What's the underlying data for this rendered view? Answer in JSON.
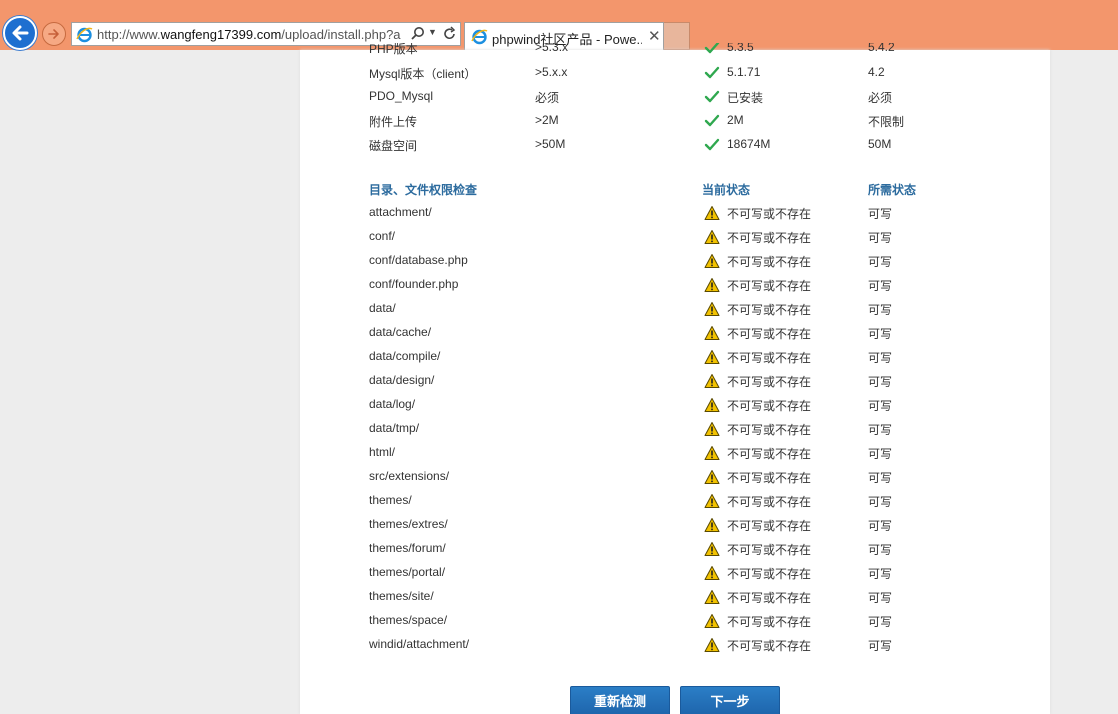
{
  "browser": {
    "url_prefix": "http://www.",
    "url_domain": "wangfeng17399.com",
    "url_path": "/upload/install.php?a",
    "tab_title": "phpwind社区产品 - Powe...",
    "tab_close": "✕"
  },
  "env_partial_row": {
    "name": "PHP版本",
    "required": ">5.3.x",
    "current": "5.3.5",
    "recommended": "5.4.2"
  },
  "env_rows": [
    {
      "name": "Mysql版本（client）",
      "required": ">5.x.x",
      "current": "5.1.71",
      "recommended": "4.2"
    },
    {
      "name": "PDO_Mysql",
      "required": "必须",
      "current": "已安装",
      "recommended": "必须"
    },
    {
      "name": "附件上传",
      "required": ">2M",
      "current": "2M",
      "recommended": "不限制"
    },
    {
      "name": "磁盘空间",
      "required": ">50M",
      "current": "18674M",
      "recommended": "50M"
    }
  ],
  "perm_header": {
    "name": "目录、文件权限检查",
    "current": "当前状态",
    "required": "所需状态"
  },
  "perm_rows": [
    {
      "path": "attachment/",
      "current": "不可写或不存在",
      "required": "可写"
    },
    {
      "path": "conf/",
      "current": "不可写或不存在",
      "required": "可写"
    },
    {
      "path": "conf/database.php",
      "current": "不可写或不存在",
      "required": "可写"
    },
    {
      "path": "conf/founder.php",
      "current": "不可写或不存在",
      "required": "可写"
    },
    {
      "path": "data/",
      "current": "不可写或不存在",
      "required": "可写"
    },
    {
      "path": "data/cache/",
      "current": "不可写或不存在",
      "required": "可写"
    },
    {
      "path": "data/compile/",
      "current": "不可写或不存在",
      "required": "可写"
    },
    {
      "path": "data/design/",
      "current": "不可写或不存在",
      "required": "可写"
    },
    {
      "path": "data/log/",
      "current": "不可写或不存在",
      "required": "可写"
    },
    {
      "path": "data/tmp/",
      "current": "不可写或不存在",
      "required": "可写"
    },
    {
      "path": "html/",
      "current": "不可写或不存在",
      "required": "可写"
    },
    {
      "path": "src/extensions/",
      "current": "不可写或不存在",
      "required": "可写"
    },
    {
      "path": "themes/",
      "current": "不可写或不存在",
      "required": "可写"
    },
    {
      "path": "themes/extres/",
      "current": "不可写或不存在",
      "required": "可写"
    },
    {
      "path": "themes/forum/",
      "current": "不可写或不存在",
      "required": "可写"
    },
    {
      "path": "themes/portal/",
      "current": "不可写或不存在",
      "required": "可写"
    },
    {
      "path": "themes/site/",
      "current": "不可写或不存在",
      "required": "可写"
    },
    {
      "path": "themes/space/",
      "current": "不可写或不存在",
      "required": "可写"
    },
    {
      "path": "windid/attachment/",
      "current": "不可写或不存在",
      "required": "可写"
    }
  ],
  "buttons": {
    "recheck": "重新检测",
    "next": "下一步"
  },
  "icons": {
    "ok": "check-icon",
    "warn": "warning-icon"
  },
  "colors": {
    "chrome": "#f3966c",
    "header_text": "#2c6b9e",
    "button": "#1e6fb8",
    "check": "#2fa84f",
    "warn": "#f2c200"
  }
}
